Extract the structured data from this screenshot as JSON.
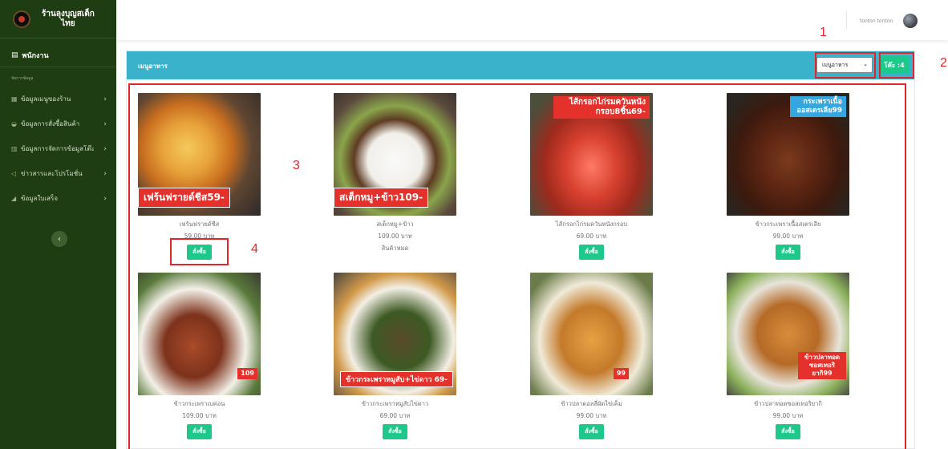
{
  "brand": {
    "name_line1": "ร้านลุงบุญสเต็ก",
    "name_line2": "ไทย"
  },
  "sidebar": {
    "dashboard_label": "พนักงาน",
    "section_title": "จัดการข้อมูล",
    "items": [
      {
        "label": "ข้อมูลเมนูของร้าน",
        "icon": "table-icon"
      },
      {
        "label": "ข้อมูลการสั่งซื้อสินค้า",
        "icon": "shopping-bag-icon"
      },
      {
        "label": "ข้อมูลการจัดการข้อมูลโต๊ะ",
        "icon": "database-icon"
      },
      {
        "label": "ข่าวสารและโปรโมชั่น",
        "icon": "megaphone-icon"
      },
      {
        "label": "ข้อมูลใบเสร็จ",
        "icon": "chart-icon"
      }
    ],
    "toggle_glyph": "‹"
  },
  "topbar": {
    "user_name": "tonton tonton"
  },
  "card": {
    "title": "เมนูอาหาร",
    "select_value": "เมนูอาหาร",
    "table_label": "โต๊ะ :4"
  },
  "annotations": [
    "1",
    "2",
    "3",
    "4"
  ],
  "menu_items": [
    {
      "name": "เฟร้นฟรายด์ชีส",
      "price": "59.00 บาท",
      "status": "",
      "button": "สั่งซื้อ",
      "photo_tag": "เฟร้นฟรายด์ชีส59-"
    },
    {
      "name": "สเต็กหมู+ข้าว",
      "price": "109.00 บาท",
      "status": "สินค้าหมด",
      "button": "",
      "photo_tag": "สเต็กหมู+ข้าว109-"
    },
    {
      "name": "ไส้กรอกไก่รมควันหนังกรอบ",
      "price": "69.00 บาท",
      "status": "",
      "button": "สั่งซื้อ",
      "photo_tag": "ไส้กรอกไก่รมควันหนัง กรอบ8ชิ้น69-"
    },
    {
      "name": "ข้าวกระเพราเนื้อสเตรเลีย",
      "price": "99.00 บาท",
      "status": "",
      "button": "สั่งซื้อ",
      "photo_tag": "กระเพราเนื้อ ออสเตรเลีย99"
    },
    {
      "name": "ข้าวกระเพราเบค่อน",
      "price": "109.00 บาท",
      "status": "",
      "button": "สั่งซื้อ",
      "photo_tag": "109"
    },
    {
      "name": "ข้าวกระเพราหมูสับไข่ดาว",
      "price": "69.00 บาท",
      "status": "",
      "button": "สั่งซื้อ",
      "photo_tag": "ข้าวกระเพราหมูสับ+ไข่ดาว 69-"
    },
    {
      "name": "ข้าวปลาดอลลี่ผัดไข่เค็ม",
      "price": "99.00 บาท",
      "status": "",
      "button": "สั่งซื้อ",
      "photo_tag": "99"
    },
    {
      "name": "ข้าวปลาทอดซอสเทอริยากิ",
      "price": "99.00 บาท",
      "status": "",
      "button": "สั่งซื้อ",
      "photo_tag": "ข้าวปลาทอด ซอสเทอริยากิ99"
    }
  ]
}
